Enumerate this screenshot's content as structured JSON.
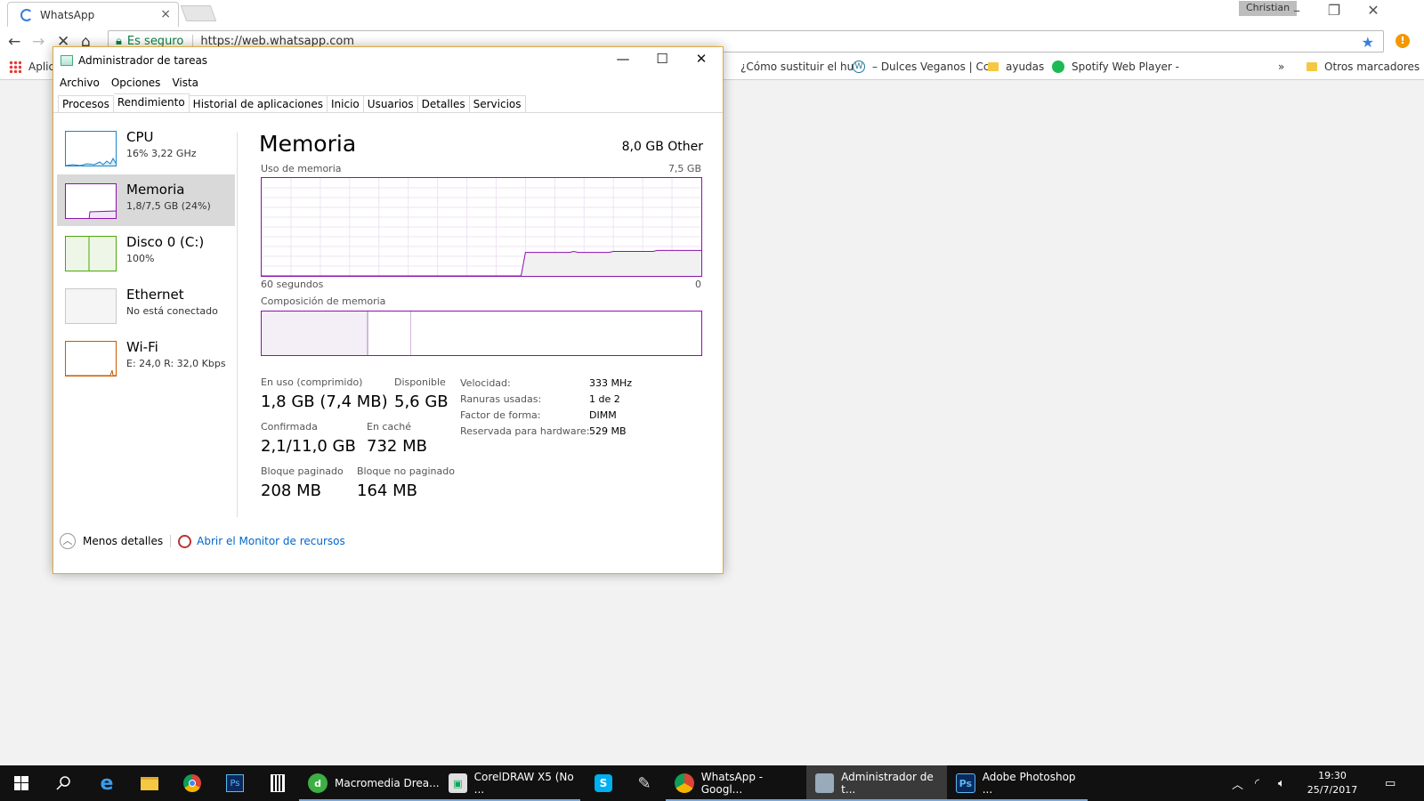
{
  "browser": {
    "tab_title": "WhatsApp",
    "tab_close": "×",
    "user": "Christian",
    "secure_label": "Es seguro",
    "url": "https://web.whatsapp.com",
    "bookmarks": {
      "apps": "Aplic",
      "b1": "¿Cómo sustituir el hu",
      "b2": "– Dulces Veganos | Cc",
      "b3": "ayudas",
      "b4": "Spotify Web Player - ",
      "more": "»",
      "other": "Otros marcadores"
    }
  },
  "taskmgr": {
    "title": "Administrador de tareas",
    "menu": [
      "Archivo",
      "Opciones",
      "Vista"
    ],
    "tabs": [
      "Procesos",
      "Rendimiento",
      "Historial de aplicaciones",
      "Inicio",
      "Usuarios",
      "Detalles",
      "Servicios"
    ],
    "active_tab": "Rendimiento",
    "sidebar": [
      {
        "name": "CPU",
        "sub": "16% 3,22 GHz",
        "color": "#1a86c9"
      },
      {
        "name": "Memoria",
        "sub": "1,8/7,5 GB (24%)",
        "color": "#8b12ae"
      },
      {
        "name": "Disco 0 (C:)",
        "sub": "100%",
        "color": "#4da60c"
      },
      {
        "name": "Ethernet",
        "sub": "No está conectado",
        "color": "#c8c8c8"
      },
      {
        "name": "Wi-Fi",
        "sub": "E: 24,0 R: 32,0 Kbps",
        "color": "#c75a00"
      }
    ],
    "memory": {
      "title": "Memoria",
      "total": "8,0 GB Other",
      "usage_label": "Uso de memoria",
      "usage_max": "7,5 GB",
      "time_left": "60 segundos",
      "time_right": "0",
      "composition_label": "Composición de memoria",
      "stats": {
        "in_use_label": "En uso (comprimido)",
        "in_use": "1,8 GB (7,4 MB)",
        "available_label": "Disponible",
        "available": "5,6 GB",
        "committed_label": "Confirmada",
        "committed": "2,1/11,0 GB",
        "cached_label": "En caché",
        "cached": "732 MB",
        "paged_label": "Bloque paginado",
        "paged": "208 MB",
        "nonpaged_label": "Bloque no paginado",
        "nonpaged": "164 MB"
      },
      "details": [
        {
          "k": "Velocidad:",
          "v": "333 MHz"
        },
        {
          "k": "Ranuras usadas:",
          "v": "1 de 2"
        },
        {
          "k": "Factor de forma:",
          "v": "DIMM"
        },
        {
          "k": "Reservada para hardware:",
          "v": "529 MB"
        }
      ],
      "usage_series_percent": [
        0,
        0,
        0,
        0,
        0,
        0,
        0,
        0,
        0,
        0,
        0,
        0,
        0,
        0,
        0,
        0,
        0,
        0,
        0,
        0,
        0,
        0,
        0,
        0,
        0,
        0,
        0,
        0,
        0,
        0,
        0,
        0,
        0,
        0,
        0,
        0,
        0,
        0,
        0,
        0,
        0,
        0,
        0,
        0,
        0,
        0,
        0,
        0,
        0,
        0,
        0,
        0,
        0,
        0,
        0,
        0,
        0,
        0,
        0,
        0,
        24,
        24,
        24,
        24,
        24,
        24,
        24,
        24,
        24,
        24,
        24,
        25,
        24,
        24,
        24,
        24,
        24,
        24,
        24,
        24,
        25,
        25,
        25,
        25,
        25,
        25,
        25,
        25,
        25,
        25,
        26,
        26,
        26,
        26,
        26,
        26,
        26,
        26,
        26,
        26,
        26
      ]
    },
    "footer": {
      "less_details": "Menos detalles",
      "resource_monitor": "Abrir el Monitor de recursos"
    }
  },
  "taskbar": {
    "apps": [
      {
        "label": "Macromedia Drea...",
        "color": "#3cb043"
      },
      {
        "label": "CorelDRAW X5 (No ...",
        "color": "#e0e0e0"
      },
      {
        "label": "WhatsApp - Googl...",
        "color": "#db4437"
      },
      {
        "label": "Administrador de t...",
        "color": "#9ab"
      },
      {
        "label": "Adobe Photoshop ...",
        "color": "#0a2a5e"
      }
    ],
    "time": "19:30",
    "date": "25/7/2017"
  }
}
